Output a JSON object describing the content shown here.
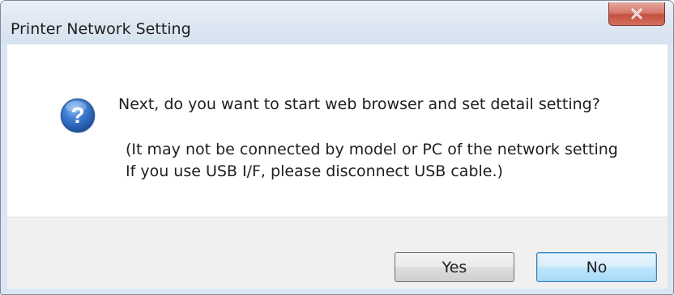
{
  "window": {
    "title": "Printer Network Setting",
    "close_icon": "close-icon"
  },
  "dialog": {
    "icon": "question-icon",
    "message": "Next, do you want to start web browser and set detail setting?",
    "detail_lines": [
      "(It may not be connected by model or PC of the network setting",
      "If you use USB I/F, please disconnect USB cable.)"
    ]
  },
  "buttons": {
    "yes_label": "Yes",
    "no_label": "No",
    "default": "No"
  },
  "colors": {
    "close_button": "#c5503f",
    "default_button_border": "#3c7fb1",
    "question_icon": "#2f67b8"
  }
}
